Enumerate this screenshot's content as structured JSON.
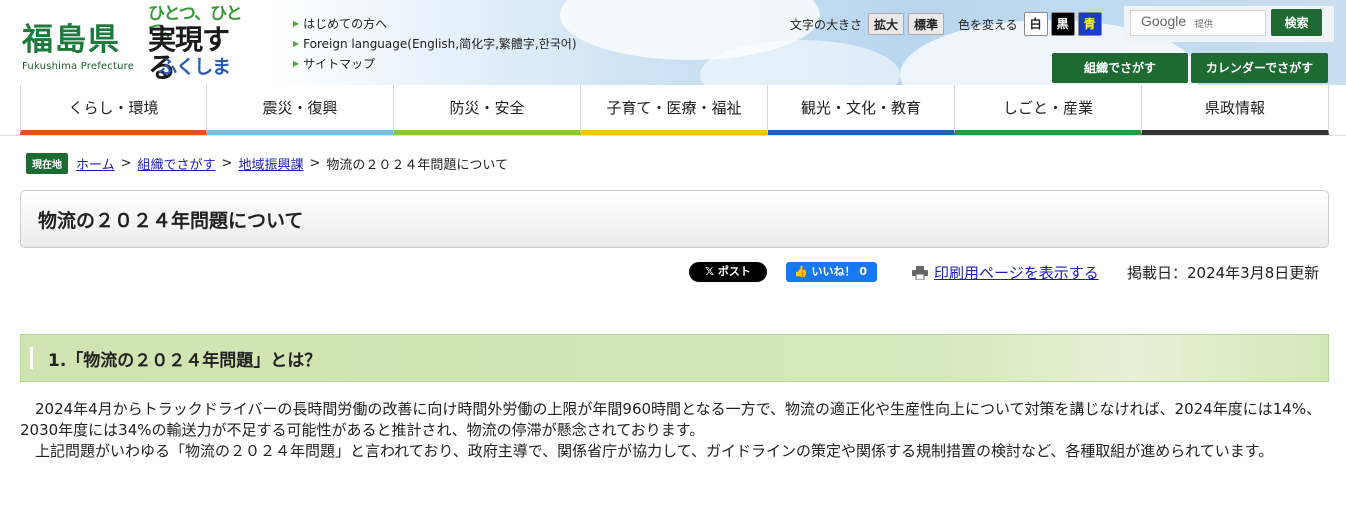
{
  "header": {
    "logo_kanji": "福島県",
    "logo_en": "Fukushima Prefecture",
    "slogan": {
      "line1": "ひとつ、ひとつ、",
      "line2": "実現する",
      "line3": "ふくしま"
    },
    "quick_links": [
      "はじめての方へ",
      "Foreign language(English,简化字,繁體字,한국어)",
      "サイトマップ"
    ],
    "text_size_label": "文字の大きさ",
    "text_size_buttons": [
      "拡大",
      "標準"
    ],
    "color_label": "色を変える",
    "color_buttons": [
      "白",
      "黒",
      "青"
    ],
    "search": {
      "brand": "Google",
      "sub": "提供",
      "button": "検索"
    },
    "find_buttons": [
      "組織でさがす",
      "カレンダーでさがす"
    ]
  },
  "nav": {
    "items": [
      {
        "label": "くらし・環境",
        "color": "#d9541e"
      },
      {
        "label": "震災・復興",
        "color": "#74c2ea"
      },
      {
        "label": "防災・安全",
        "color": "#8cc63f"
      },
      {
        "label": "子育て・医療・福祉",
        "color": "#f6c500"
      },
      {
        "label": "観光・文化・教育",
        "color": "#1c63b0"
      },
      {
        "label": "しごと・産業",
        "color": "#2d9a44"
      },
      {
        "label": "県政情報",
        "color": "#333333"
      }
    ]
  },
  "breadcrumb": {
    "here_label": "現在地",
    "links": [
      "ホーム",
      "組織でさがす",
      "地域振興課"
    ],
    "current": "物流の２０２４年問題について"
  },
  "page": {
    "title": "物流の２０２４年問題について",
    "share": {
      "x_post": "ポスト",
      "fb_like": "いいね！ 0"
    },
    "print_link": "印刷用ページを表示する",
    "posted": "掲載日：2024年3月8日更新"
  },
  "section1": {
    "heading": "1.「物流の２０２４年問題」とは？",
    "paragraphs": [
      "2024年4月からトラックドライバーの長時間労働の改善に向け時間外労働の上限が年間960時間となる一方で、物流の適正化や生産性向上について対策を講じなければ、2024年度には14%、2030年度には34%の輸送力が不足する可能性があると推計され、物流の停滞が懸念されております。",
      "上記問題がいわゆる「物流の２０２４年問題」と言われており、政府主導で、関係省庁が協力して、ガイドラインの策定や関係する規制措置の検討など、各種取組が進められています。"
    ]
  }
}
